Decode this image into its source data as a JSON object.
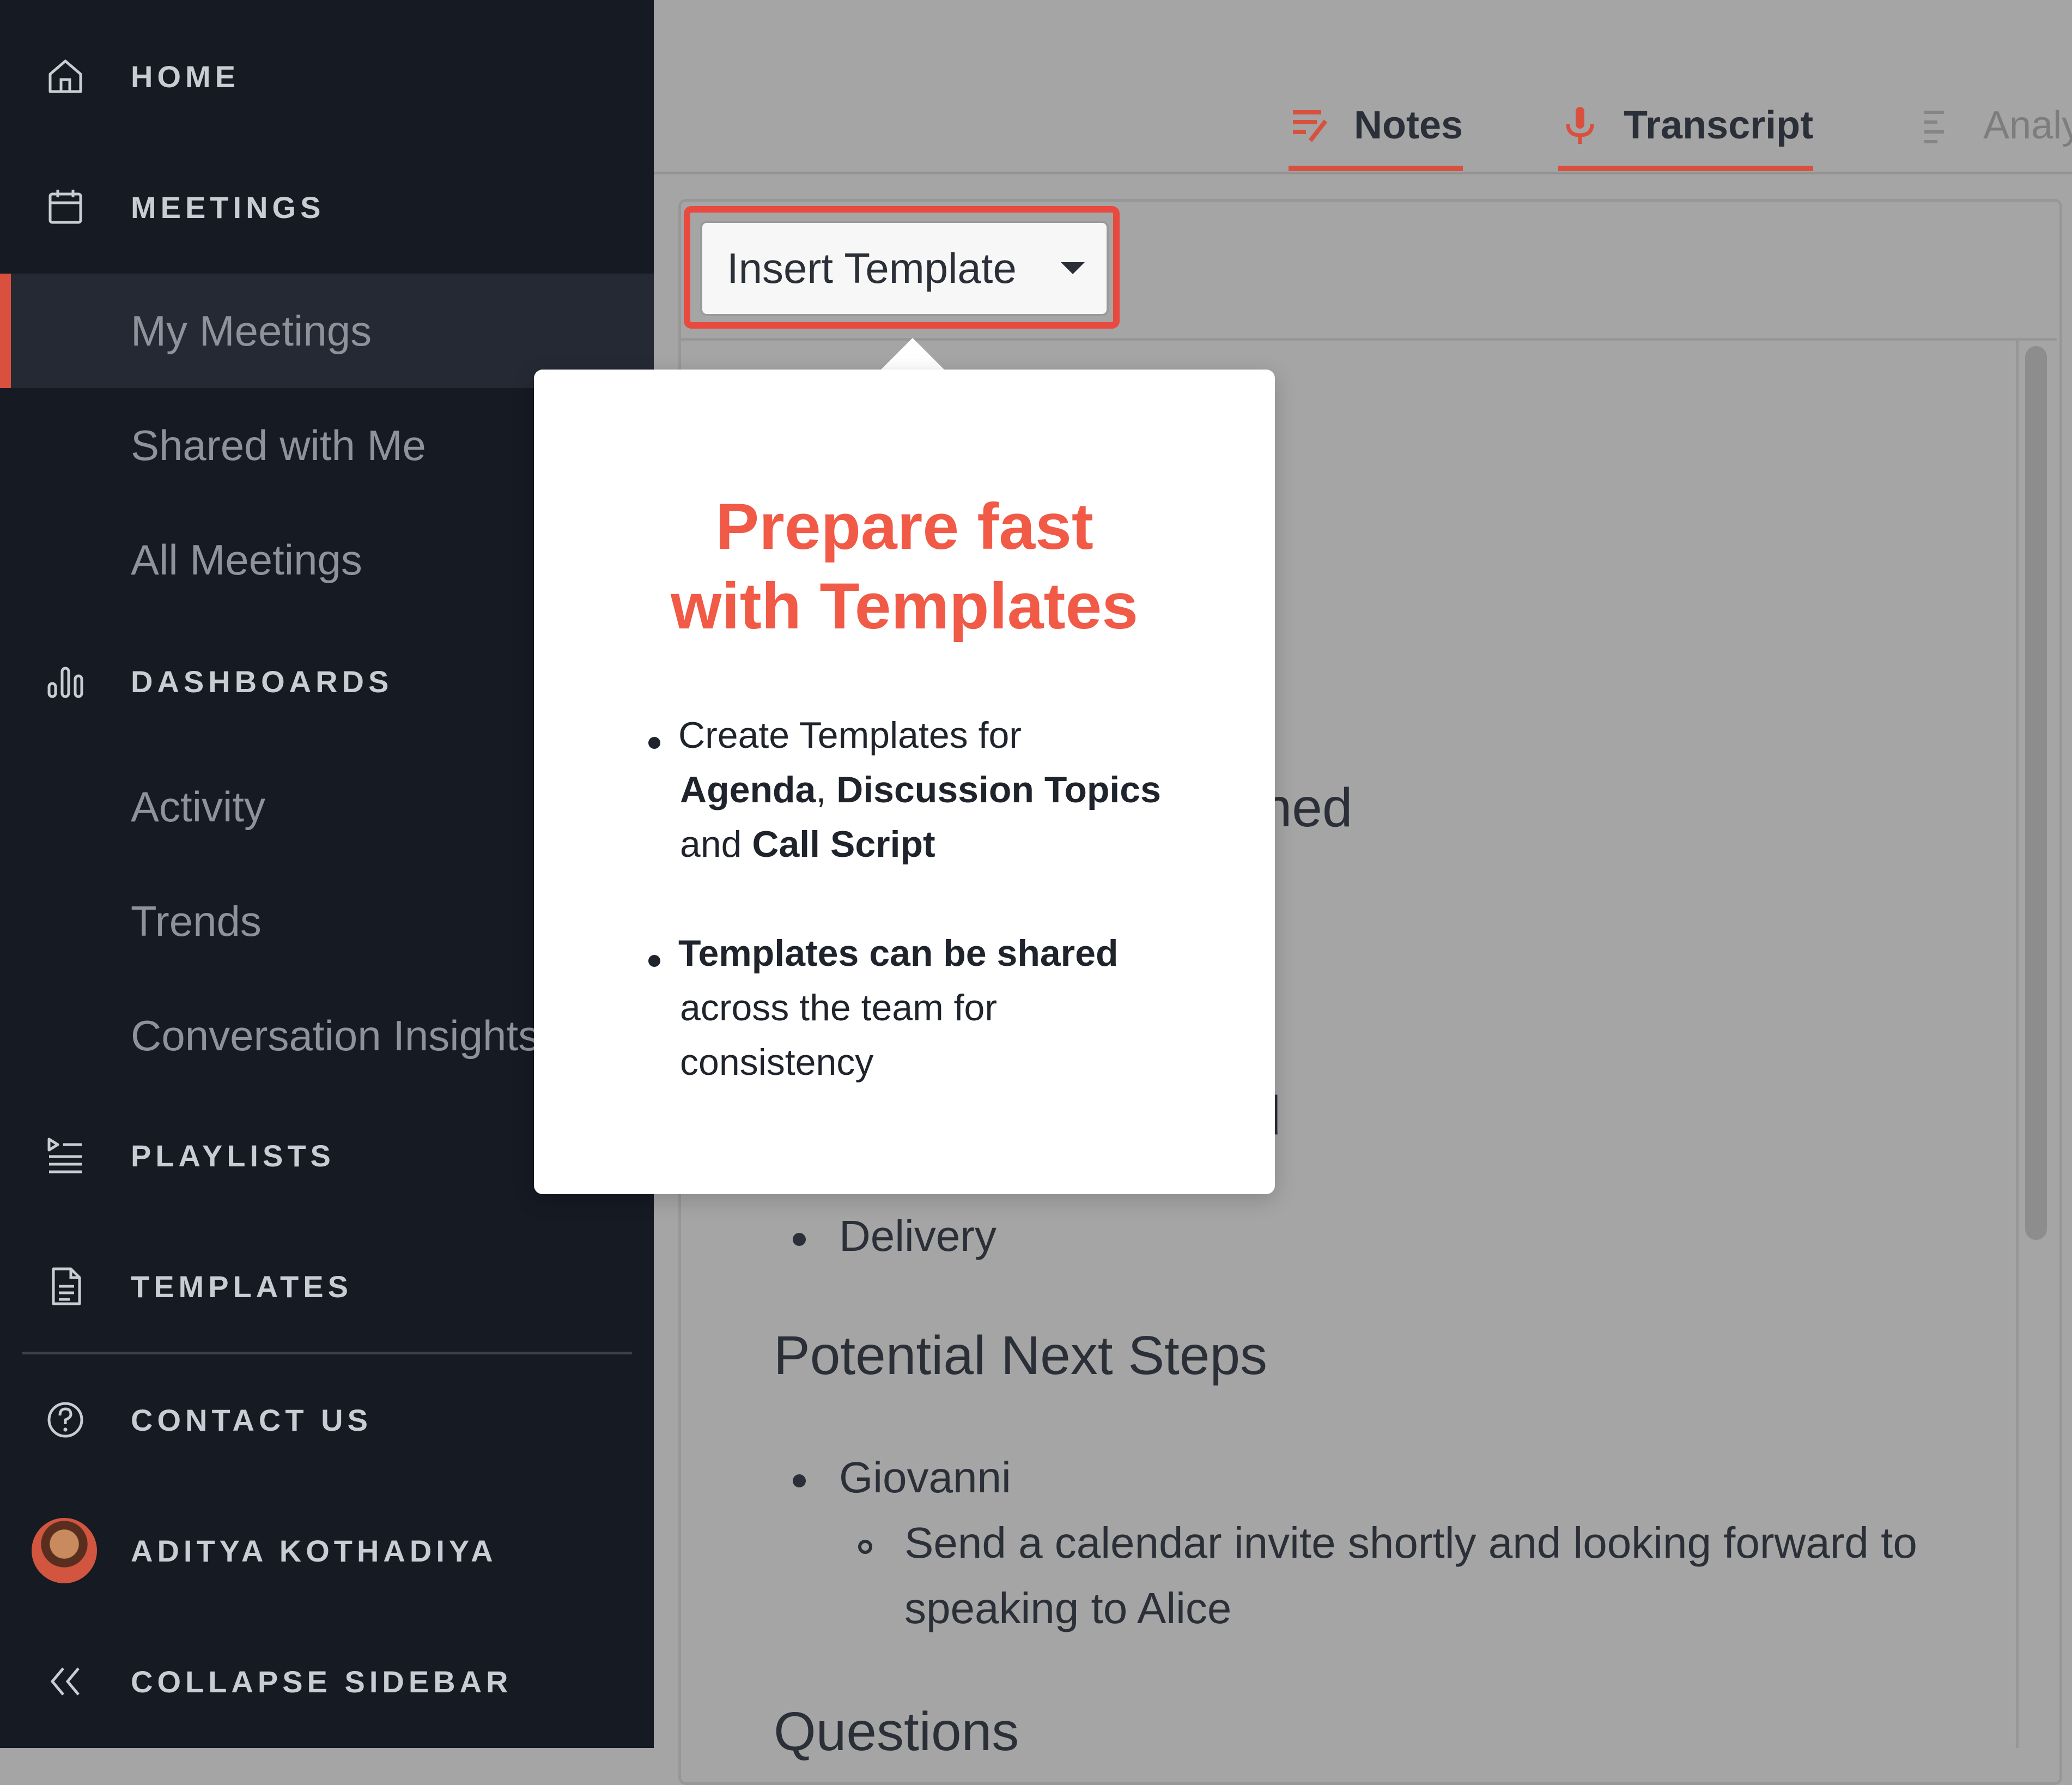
{
  "sidebar": {
    "sections": {
      "home": "HOME",
      "meetings": "MEETINGS",
      "dashboards": "DASHBOARDS",
      "playlists": "PLAYLISTS",
      "templates": "TEMPLATES",
      "contact": "CONTACT US",
      "user": "ADITYA KOTHADIYA",
      "collapse": "COLLAPSE SIDEBAR"
    },
    "meetings_items": [
      "My Meetings",
      "Shared with Me",
      "All Meetings"
    ],
    "dashboards_items": [
      "Activity",
      "Trends",
      "Conversation Insights"
    ]
  },
  "tabs": {
    "notes": "Notes",
    "transcript": "Transcript",
    "analytics": "Analy"
  },
  "toolbar": {
    "insert_template": "Insert Template"
  },
  "document": {
    "heading_partial_1": "oned",
    "heading_partial_2": "ed",
    "bullet_delivery": "Delivery",
    "heading_next_steps": "Potential Next Steps",
    "bullet_giovanni": "Giovanni",
    "sub_bullet_line1": "Send a calendar invite shortly and looking forward to",
    "sub_bullet_line2": "speaking to Alice",
    "heading_questions": "Questions"
  },
  "popover": {
    "title_line1": "Prepare fast",
    "title_line2": "with Templates",
    "b1_l1": "Create Templates for",
    "b1_agenda": "Agenda",
    "b1_comma": ", ",
    "b1_topics": "Discussion Topics",
    "b1_and": "and ",
    "b1_script": "Call Script",
    "b2_bold": "Templates can be shared",
    "b2_l2": "across the team for",
    "b2_l3": "consistency"
  },
  "colors": {
    "sidebar_bg": "#151a23",
    "accent": "#d9503e",
    "highlight": "#e94a3f",
    "popover_title": "#f05a46"
  }
}
